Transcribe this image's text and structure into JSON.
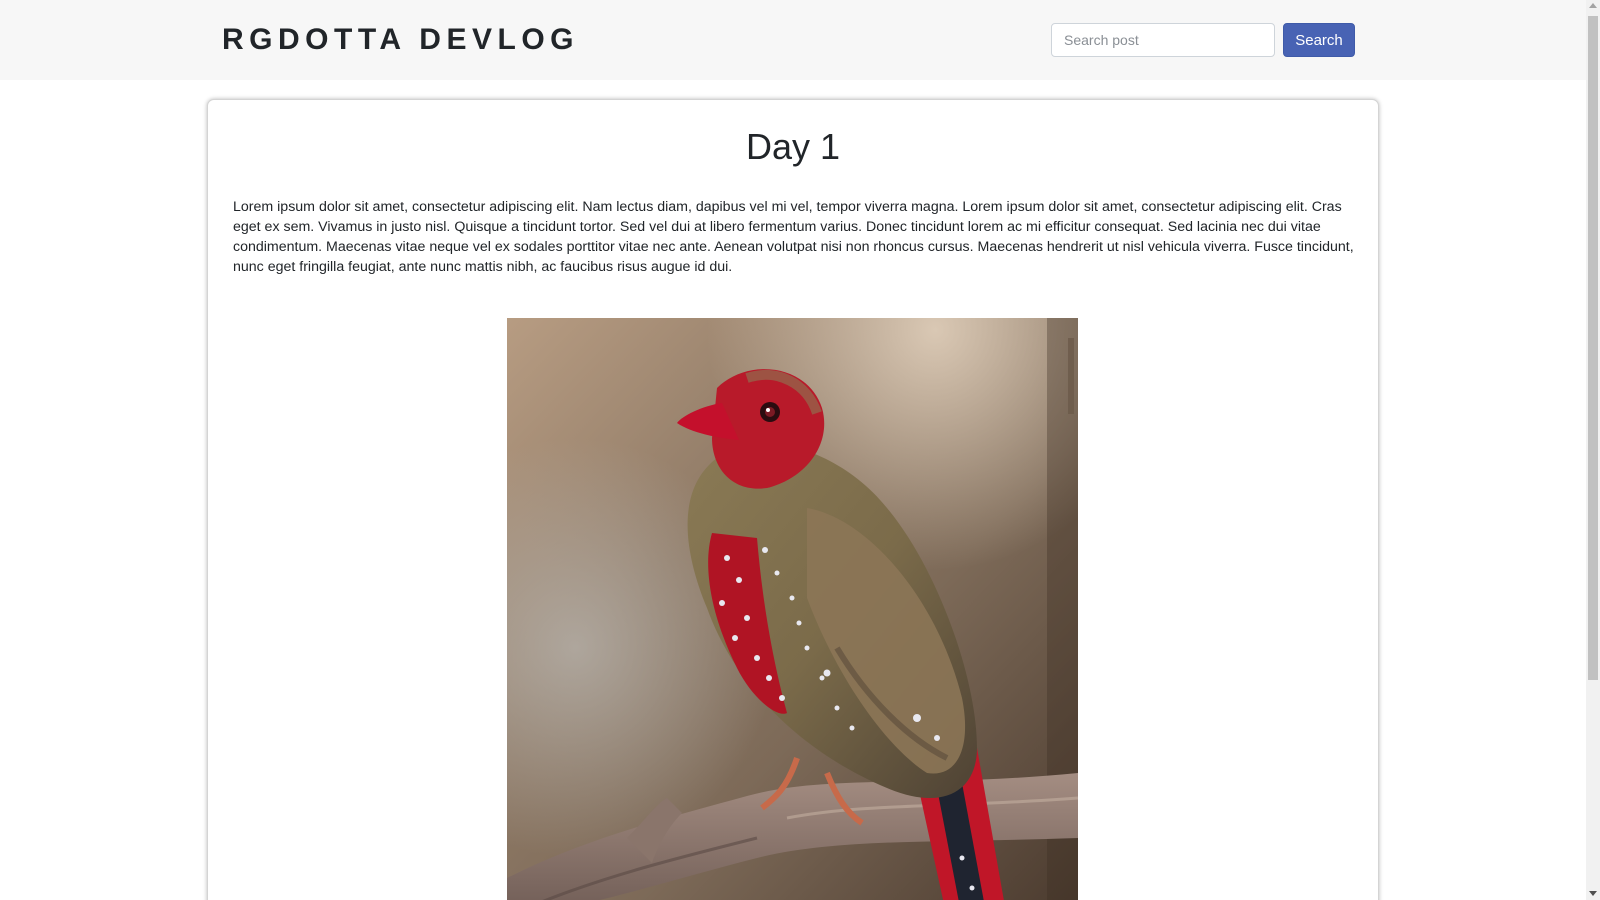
{
  "header": {
    "brand": "RGDOTTA DEVLOG",
    "search": {
      "placeholder": "Search post",
      "value": "",
      "button_label": "Search"
    }
  },
  "post": {
    "title": "Day 1",
    "body": "Lorem ipsum dolor sit amet, consectetur adipiscing elit. Nam lectus diam, dapibus vel mi vel, tempor viverra magna. Lorem ipsum dolor sit amet, consectetur adipiscing elit. Cras eget ex sem. Vivamus in justo nisl. Quisque a tincidunt tortor. Sed vel dui at libero fermentum varius. Donec tincidunt lorem ac mi efficitur consequat. Sed lacinia nec dui vitae condimentum. Maecenas vitae neque vel ex sodales porttitor vitae nec ante. Aenean volutpat nisi non rhoncus cursus. Maecenas hendrerit ut nisl vehicula viverra. Fusce tincidunt, nunc eget fringilla feugiat, ante nunc mattis nibh, ac faucibus risus augue id dui.",
    "image": {
      "subject": "red-finch-on-branch"
    }
  },
  "colors": {
    "header_background": "#f7f7f7",
    "accent": "#4863b4",
    "text": "#212529",
    "card_border": "#d4d4d4"
  }
}
